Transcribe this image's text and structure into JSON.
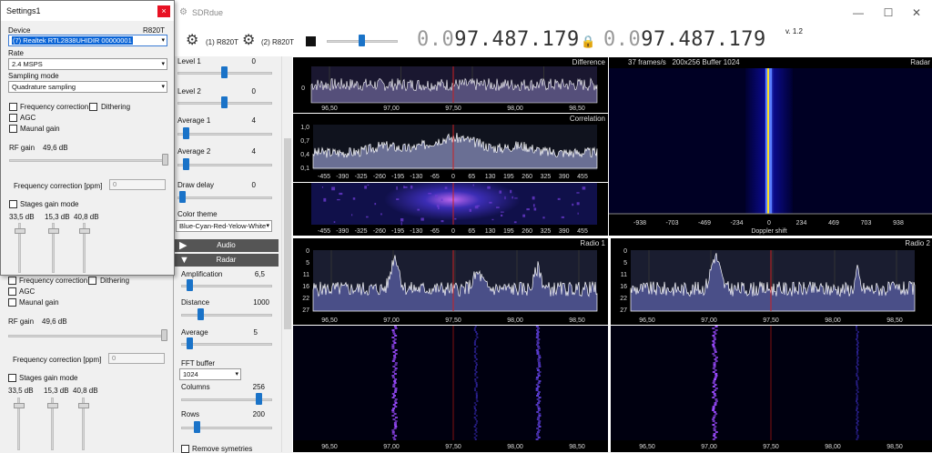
{
  "window": {
    "title": "SDRdue",
    "minimize": "—",
    "maximize": "☐",
    "close": "✕"
  },
  "toolbar": {
    "device1": "(1) R820T",
    "device2": "(2) R820T",
    "freq1_dim": "0.0",
    "freq1": "97.487.179",
    "freq2_dim": "0.0",
    "freq2": "97.487.179",
    "version": "v. 1.2"
  },
  "controls": {
    "level1": {
      "label": "Level 1",
      "value": "0"
    },
    "level2": {
      "label": "Level 2",
      "value": "0"
    },
    "average1": {
      "label": "Average 1",
      "value": "4"
    },
    "average2": {
      "label": "Average 2",
      "value": "4"
    },
    "draw_delay": {
      "label": "Draw delay",
      "value": "0"
    },
    "color_theme": {
      "label": "Color theme",
      "value": "Blue-Cyan-Red-Yelow-White"
    },
    "audio_bar": "Audio",
    "radar_bar": "Radar",
    "amplification": {
      "label": "Amplification",
      "value": "6,5"
    },
    "distance": {
      "label": "Distance",
      "value": "1000"
    },
    "average": {
      "label": "Average",
      "value": "5"
    },
    "fft_buffer": {
      "label": "FFT buffer",
      "value": "1024"
    },
    "columns": {
      "label": "Columns",
      "value": "256"
    },
    "rows": {
      "label": "Rows",
      "value": "200"
    },
    "remove_symmetries": "Remove symetries"
  },
  "plots": {
    "difference": {
      "title": "Difference",
      "xticks": [
        "96,50",
        "97,00",
        "97,50",
        "98,00",
        "98,50"
      ],
      "ytick": "0"
    },
    "correlation": {
      "title": "Correlation",
      "xticks": [
        "-455",
        "-390",
        "-325",
        "-260",
        "-195",
        "-130",
        "-65",
        "0",
        "65",
        "130",
        "195",
        "260",
        "325",
        "390",
        "455"
      ],
      "yticks": [
        "1,0",
        "0,7",
        "0,4",
        "0,1"
      ]
    },
    "spectrogram_ticks": [
      "-455",
      "-390",
      "-325",
      "-260",
      "-195",
      "-130",
      "-65",
      "0",
      "65",
      "130",
      "195",
      "260",
      "325",
      "390",
      "455"
    ],
    "radar": {
      "title": "Radar",
      "info": "37 frames/s   200x256 Buffer 1024",
      "xticks": [
        "-938",
        "-703",
        "-469",
        "-234",
        "0",
        "234",
        "469",
        "703",
        "938"
      ],
      "xlabel": "Doppler shift"
    },
    "radio1": {
      "title": "Radio 1",
      "xticks": [
        "96,50",
        "97,00",
        "97,50",
        "98,00",
        "98,50"
      ],
      "yticks": [
        "0",
        "5",
        "11",
        "16",
        "22",
        "27"
      ]
    },
    "radio2": {
      "title": "Radio 2",
      "xticks": [
        "96,50",
        "97,00",
        "97,50",
        "98,00",
        "98,50"
      ],
      "yticks": [
        "0",
        "5",
        "11",
        "16",
        "22",
        "27"
      ]
    },
    "waterfall_ticks": [
      "96,50",
      "97,00",
      "97,50",
      "98,00",
      "98,50"
    ]
  },
  "settings": {
    "title": "Settings1",
    "close": "×",
    "device_label": "Device",
    "device_type": "R820T",
    "device_value": "(7) Realtek RTL2838UHIDIR 00000001",
    "rate_label": "Rate",
    "rate_value": "2.4 MSPS",
    "sampling_label": "Sampling mode",
    "sampling_value": "Quadrature sampling",
    "freq_correction": "Frequency correction",
    "dithering": "Dithering",
    "agc": "AGC",
    "manual_gain": "Maunal gain",
    "rf_gain_label": "RF gain",
    "rf_gain_value": "49,6 dB",
    "freq_corr_ppm": "Frequency correction [ppm]",
    "ppm_value": "0",
    "stages_gain": "Stages gain mode",
    "stage_values": [
      "33,5 dB",
      "15,3 dB",
      "40,8 dB"
    ]
  },
  "settings2": {
    "freq_correction": "Frequency correction",
    "dithering": "Dithering",
    "agc": "AGC",
    "manual_gain": "Maunal gain",
    "rf_gain_label": "RF gain",
    "rf_gain_value": "49,6 dB",
    "freq_corr_ppm": "Frequency correction [ppm]",
    "ppm_value": "0",
    "stages_gain": "Stages gain mode",
    "stage_values": [
      "33,5 dB",
      "15,3 dB",
      "40,8 dB"
    ]
  }
}
